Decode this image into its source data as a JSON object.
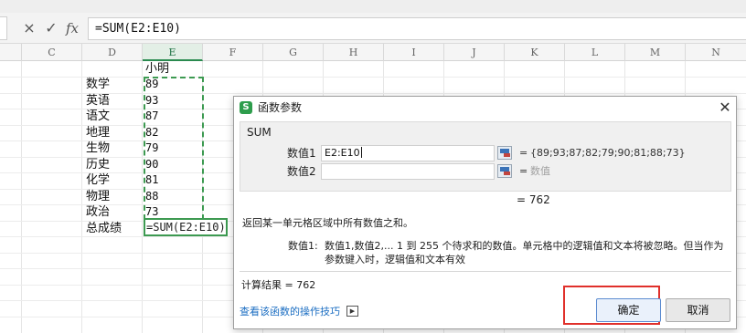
{
  "formula_bar": {
    "cancel_icon": "×",
    "confirm_icon": "✓",
    "fx_label": "fx",
    "formula": "=SUM(E2:E10)"
  },
  "columns": [
    "C",
    "D",
    "E",
    "F",
    "G",
    "H",
    "I",
    "J",
    "K",
    "L",
    "M",
    "N"
  ],
  "active_column": "E",
  "sheet": {
    "header_e1": "小明",
    "rows": [
      {
        "subject": "数学",
        "score": "89"
      },
      {
        "subject": "英语",
        "score": "93"
      },
      {
        "subject": "语文",
        "score": "87"
      },
      {
        "subject": "地理",
        "score": "82"
      },
      {
        "subject": "生物",
        "score": "79"
      },
      {
        "subject": "历史",
        "score": "90"
      },
      {
        "subject": "化学",
        "score": "81"
      },
      {
        "subject": "物理",
        "score": "88"
      },
      {
        "subject": "政治",
        "score": "73"
      }
    ],
    "total_label": "总成绩",
    "total_formula": "=SUM(E2:E10)"
  },
  "dialog": {
    "app_icon": "S",
    "title": "函数参数",
    "close_icon": "✕",
    "function_name": "SUM",
    "arg1_label": "数值1",
    "arg1_value": "E2:E10",
    "arg1_eq": "=",
    "arg1_eval": "{89;93;87;82;79;90;81;88;73}",
    "arg2_label": "数值2",
    "arg2_value": "",
    "arg2_eq": "=",
    "arg2_eval": "数值",
    "total_eval": "=  762",
    "description": "返回某一单元格区域中所有数值之和。",
    "arg_desc_label": "数值1:",
    "arg_desc": "数值1,数值2,... 1 到 255 个待求和的数值。单元格中的逻辑值和文本将被忽略。但当作为参数键入时，逻辑值和文本有效",
    "result": "计算结果  =  762",
    "help_link": "查看该函数的操作技巧",
    "help_icon": "▶",
    "ok_label": "确定",
    "cancel_label": "取消"
  },
  "colors": {
    "selection_green": "#3d9a51",
    "highlight_red": "#e0302b",
    "link_blue": "#1a6dc2",
    "app_icon_green": "#2e9d4c"
  }
}
